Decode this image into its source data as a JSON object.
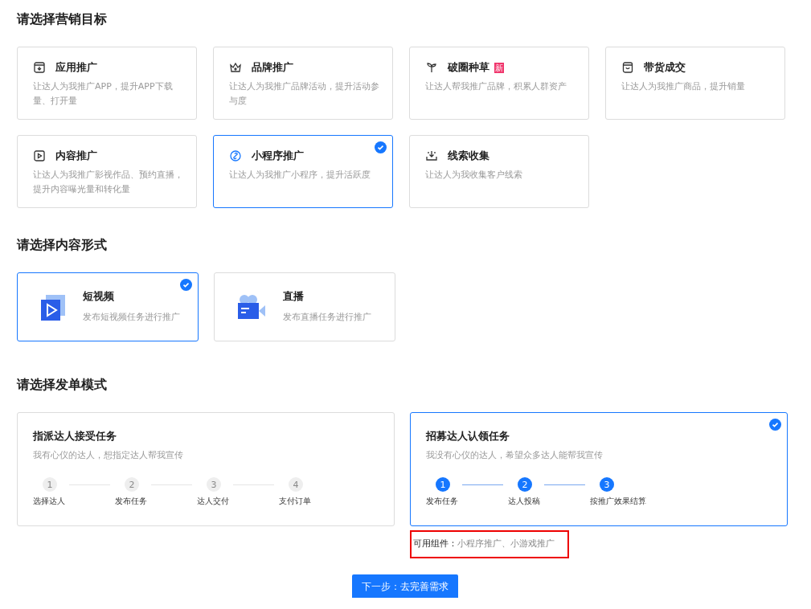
{
  "goal_section": {
    "title": "请选择营销目标",
    "options": [
      {
        "title": "应用推广",
        "desc": "让达人为我推广APP，提升APP下载量、打开量",
        "selected": false
      },
      {
        "title": "品牌推广",
        "desc": "让达人为我推广品牌活动，提升活动参与度",
        "selected": false
      },
      {
        "title": "破圈种草",
        "desc": "让达人帮我推广品牌，积累人群资产",
        "selected": false,
        "badge": "新"
      },
      {
        "title": "带货成交",
        "desc": "让达人为我推广商品，提升销量",
        "selected": false
      },
      {
        "title": "内容推广",
        "desc": "让达人为我推广影视作品、预约直播，提升内容曝光量和转化量",
        "selected": false
      },
      {
        "title": "小程序推广",
        "desc": "让达人为我推广小程序，提升活跃度",
        "selected": true
      },
      {
        "title": "线索收集",
        "desc": "让达人为我收集客户线索",
        "selected": false
      }
    ]
  },
  "format_section": {
    "title": "请选择内容形式",
    "options": [
      {
        "title": "短视频",
        "desc": "发布短视频任务进行推广",
        "selected": true
      },
      {
        "title": "直播",
        "desc": "发布直播任务进行推广",
        "selected": false
      }
    ]
  },
  "mode_section": {
    "title": "请选择发单模式",
    "options": [
      {
        "title": "指派达人接受任务",
        "desc": "我有心仪的达人，想指定达人帮我宣传",
        "selected": false,
        "steps": [
          {
            "number": "1",
            "label": "选择达人"
          },
          {
            "number": "2",
            "label": "发布任务"
          },
          {
            "number": "3",
            "label": "达人交付"
          },
          {
            "number": "4",
            "label": "支付订单"
          }
        ]
      },
      {
        "title": "招募达人认领任务",
        "desc": "我没有心仪的达人，希望众多达人能帮我宣传",
        "selected": true,
        "steps": [
          {
            "number": "1",
            "label": "发布任务"
          },
          {
            "number": "2",
            "label": "达人投稿"
          },
          {
            "number": "3",
            "label": "按推广效果结算"
          }
        ]
      }
    ],
    "available": {
      "label": "可用组件：",
      "value": "小程序推广、小游戏推广"
    }
  },
  "next_button": "下一步：去完善需求"
}
